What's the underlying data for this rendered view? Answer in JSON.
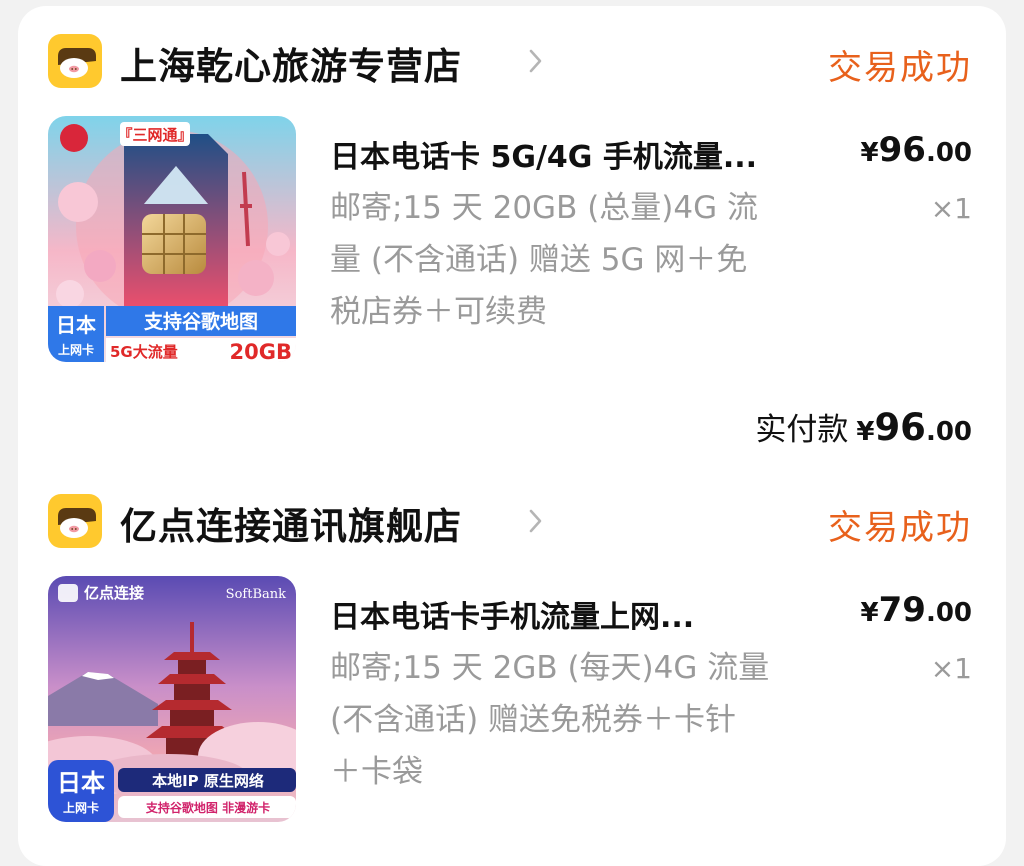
{
  "orders": [
    {
      "shop_name": "上海乾心旅游专营店",
      "status": "交易成功",
      "product": {
        "title": "日本电话卡 5G/4G 手机流量...",
        "price_currency": "¥",
        "price_integer": "96",
        "price_decimal": ".00",
        "spec_lines": [
          "邮寄;15 天 20GB (总量)4G 流",
          "量 (不含通话) 赠送 5G 网＋免",
          "税店券＋可续费"
        ],
        "quantity": "×1",
        "image_text": {
          "top_tag": "『三网通』",
          "country": "日本",
          "card_type": "上网卡",
          "feature": "支持谷歌地图",
          "speed": "5G大流量",
          "data": "20GB"
        }
      },
      "paid": {
        "label": "实付款",
        "currency": "¥",
        "integer": "96",
        "decimal": ".00"
      }
    },
    {
      "shop_name": "亿点连接通讯旗舰店",
      "status": "交易成功",
      "product": {
        "title": "日本电话卡手机流量上网...",
        "price_currency": "¥",
        "price_integer": "79",
        "price_decimal": ".00",
        "spec_lines": [
          "邮寄;15 天 2GB (每天)4G 流量",
          "(不含通话) 赠送免税券＋卡针",
          "＋卡袋"
        ],
        "quantity": "×1",
        "image_text": {
          "brand": "亿点连接",
          "carrier": "SoftBank",
          "country": "日本",
          "card_type": "上网卡",
          "feature1": "本地IP 原生网络",
          "feature2": "支持谷歌地图  非漫游卡"
        }
      }
    }
  ],
  "colors": {
    "status": "#e8611c",
    "shop_icon": "#ffc92e",
    "muted": "#9a9a9a"
  },
  "icons": {
    "shop": "pig-store-icon",
    "chevron": "chevron-right-icon"
  }
}
